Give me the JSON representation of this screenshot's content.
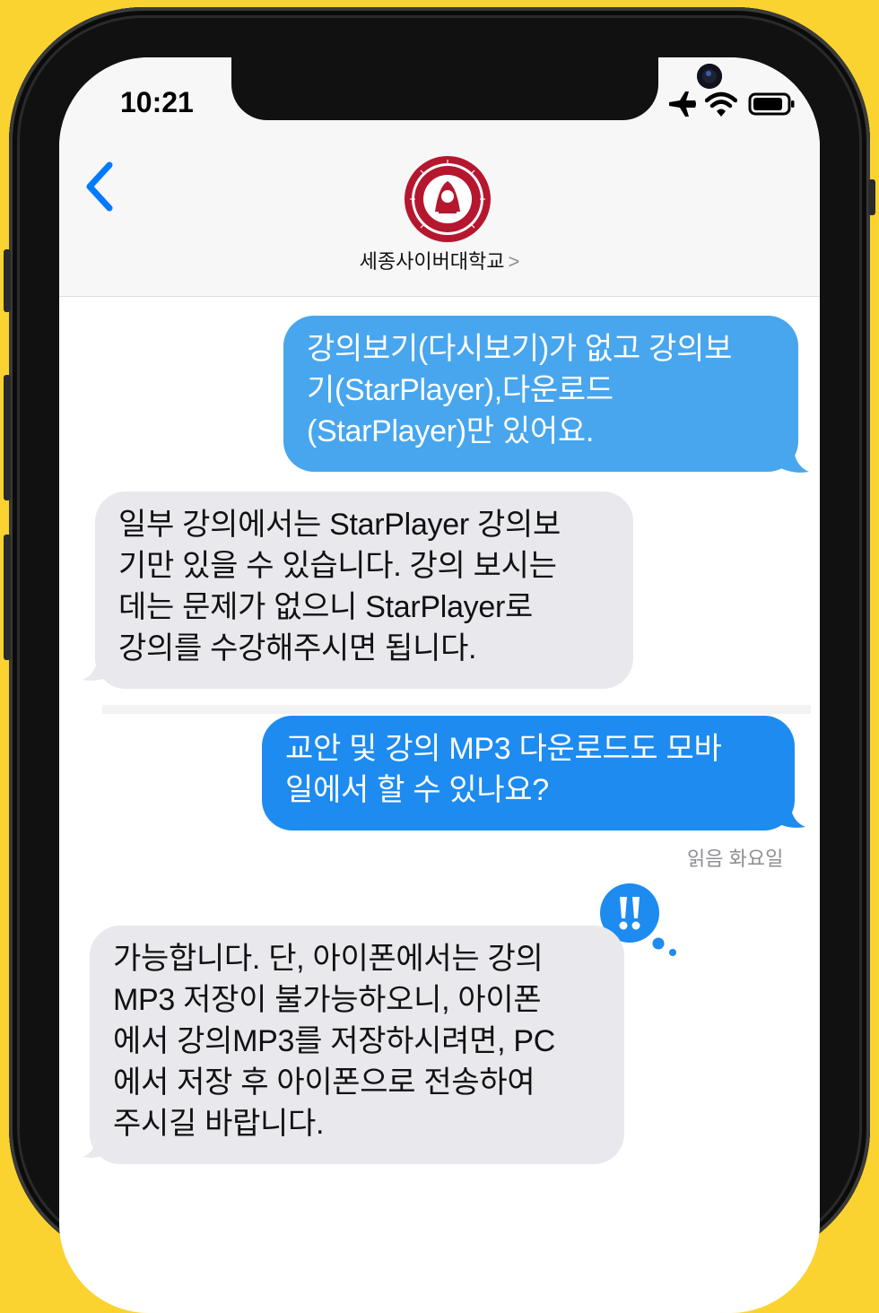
{
  "status_bar": {
    "time": "10:21"
  },
  "header": {
    "contact_name": "세종사이버대학교",
    "contact_chevron": ">"
  },
  "messages": [
    {
      "type": "sent",
      "lines": [
        "강의보기(다시보기)가 없고 강의보",
        "기(StarPlayer),다운로드",
        "(StarPlayer)만 있어요."
      ]
    },
    {
      "type": "received",
      "lines": [
        "일부 강의에서는 StarPlayer 강의보",
        "기만 있을 수 있습니다. 강의 보시는",
        "데는 문제가 없으니 StarPlayer로",
        "강의를 수강해주시면 됩니다."
      ]
    },
    {
      "type": "sent",
      "lines": [
        "교안 및 강의 MP3 다운로드도 모바",
        "일에서 할 수 있나요?"
      ]
    },
    {
      "type": "received",
      "lines": [
        "가능합니다. 단, 아이폰에서는 강의",
        "MP3 저장이 불가능하오니, 아이폰",
        "에서 강의MP3를 저장하시려면, PC",
        "에서 저장 후 아이폰으로 전송하여",
        "주시길 바랍니다."
      ]
    }
  ],
  "read_receipt": "읽음 화요일",
  "reaction": {
    "icon": "double-exclamation-icon",
    "color": "#1d8bf0"
  },
  "colors": {
    "background": "#fbd330",
    "sent_bubble": "#47a6ee",
    "sent_bubble_2": "#1d8bf0",
    "received_bubble": "#e8e8ed",
    "accent": "#007aff"
  }
}
